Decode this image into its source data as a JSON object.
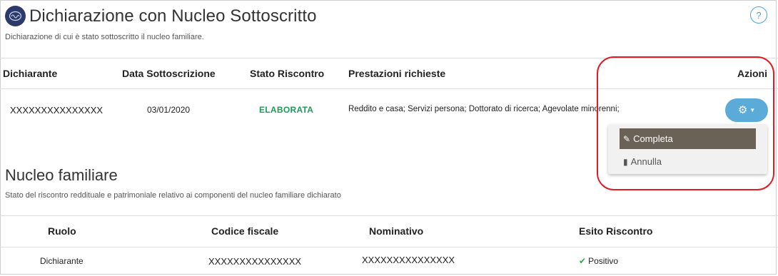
{
  "header": {
    "title": "Dichiarazione con Nucleo Sottoscritto",
    "subtitle": "Dichiarazione di cui è stato sottoscritto il nucleo familiare.",
    "help_glyph": "?"
  },
  "declaration_table": {
    "columns": [
      "Dichiarante",
      "Data Sottoscrizione",
      "Stato Riscontro",
      "Prestazioni richieste",
      "Azioni"
    ],
    "row": {
      "dichiarante": "XXXXXXXXXXXXXXX",
      "data": "03/01/2020",
      "stato": "ELABORATA",
      "prestazioni": "Reddito e casa; Servizi persona; Dottorato di ricerca; Agevolate minorenni;"
    }
  },
  "actions_menu": {
    "button_icon": "gear-icon",
    "items": [
      {
        "label": "Completa",
        "icon": "edit-icon"
      },
      {
        "label": "Annulla",
        "icon": "trash-icon"
      }
    ]
  },
  "nucleo": {
    "title": "Nucleo familiare",
    "subtitle": "Stato del riscontro reddituale e patrimoniale relativo ai componenti del nucleo familiare dichiarato",
    "columns": [
      "Ruolo",
      "Codice fiscale",
      "Nominativo",
      "Esito Riscontro"
    ],
    "row": {
      "ruolo": "Dichiarante",
      "codice": "XXXXXXXXXXXXXXX",
      "nominativo": "XXXXXXXXXXXXXXX",
      "esito": "Positivo"
    }
  },
  "colors": {
    "accent": "#5aabd8",
    "success": "#1e9b5a",
    "highlight": "#e11c24",
    "menu_active": "#6b6257"
  }
}
